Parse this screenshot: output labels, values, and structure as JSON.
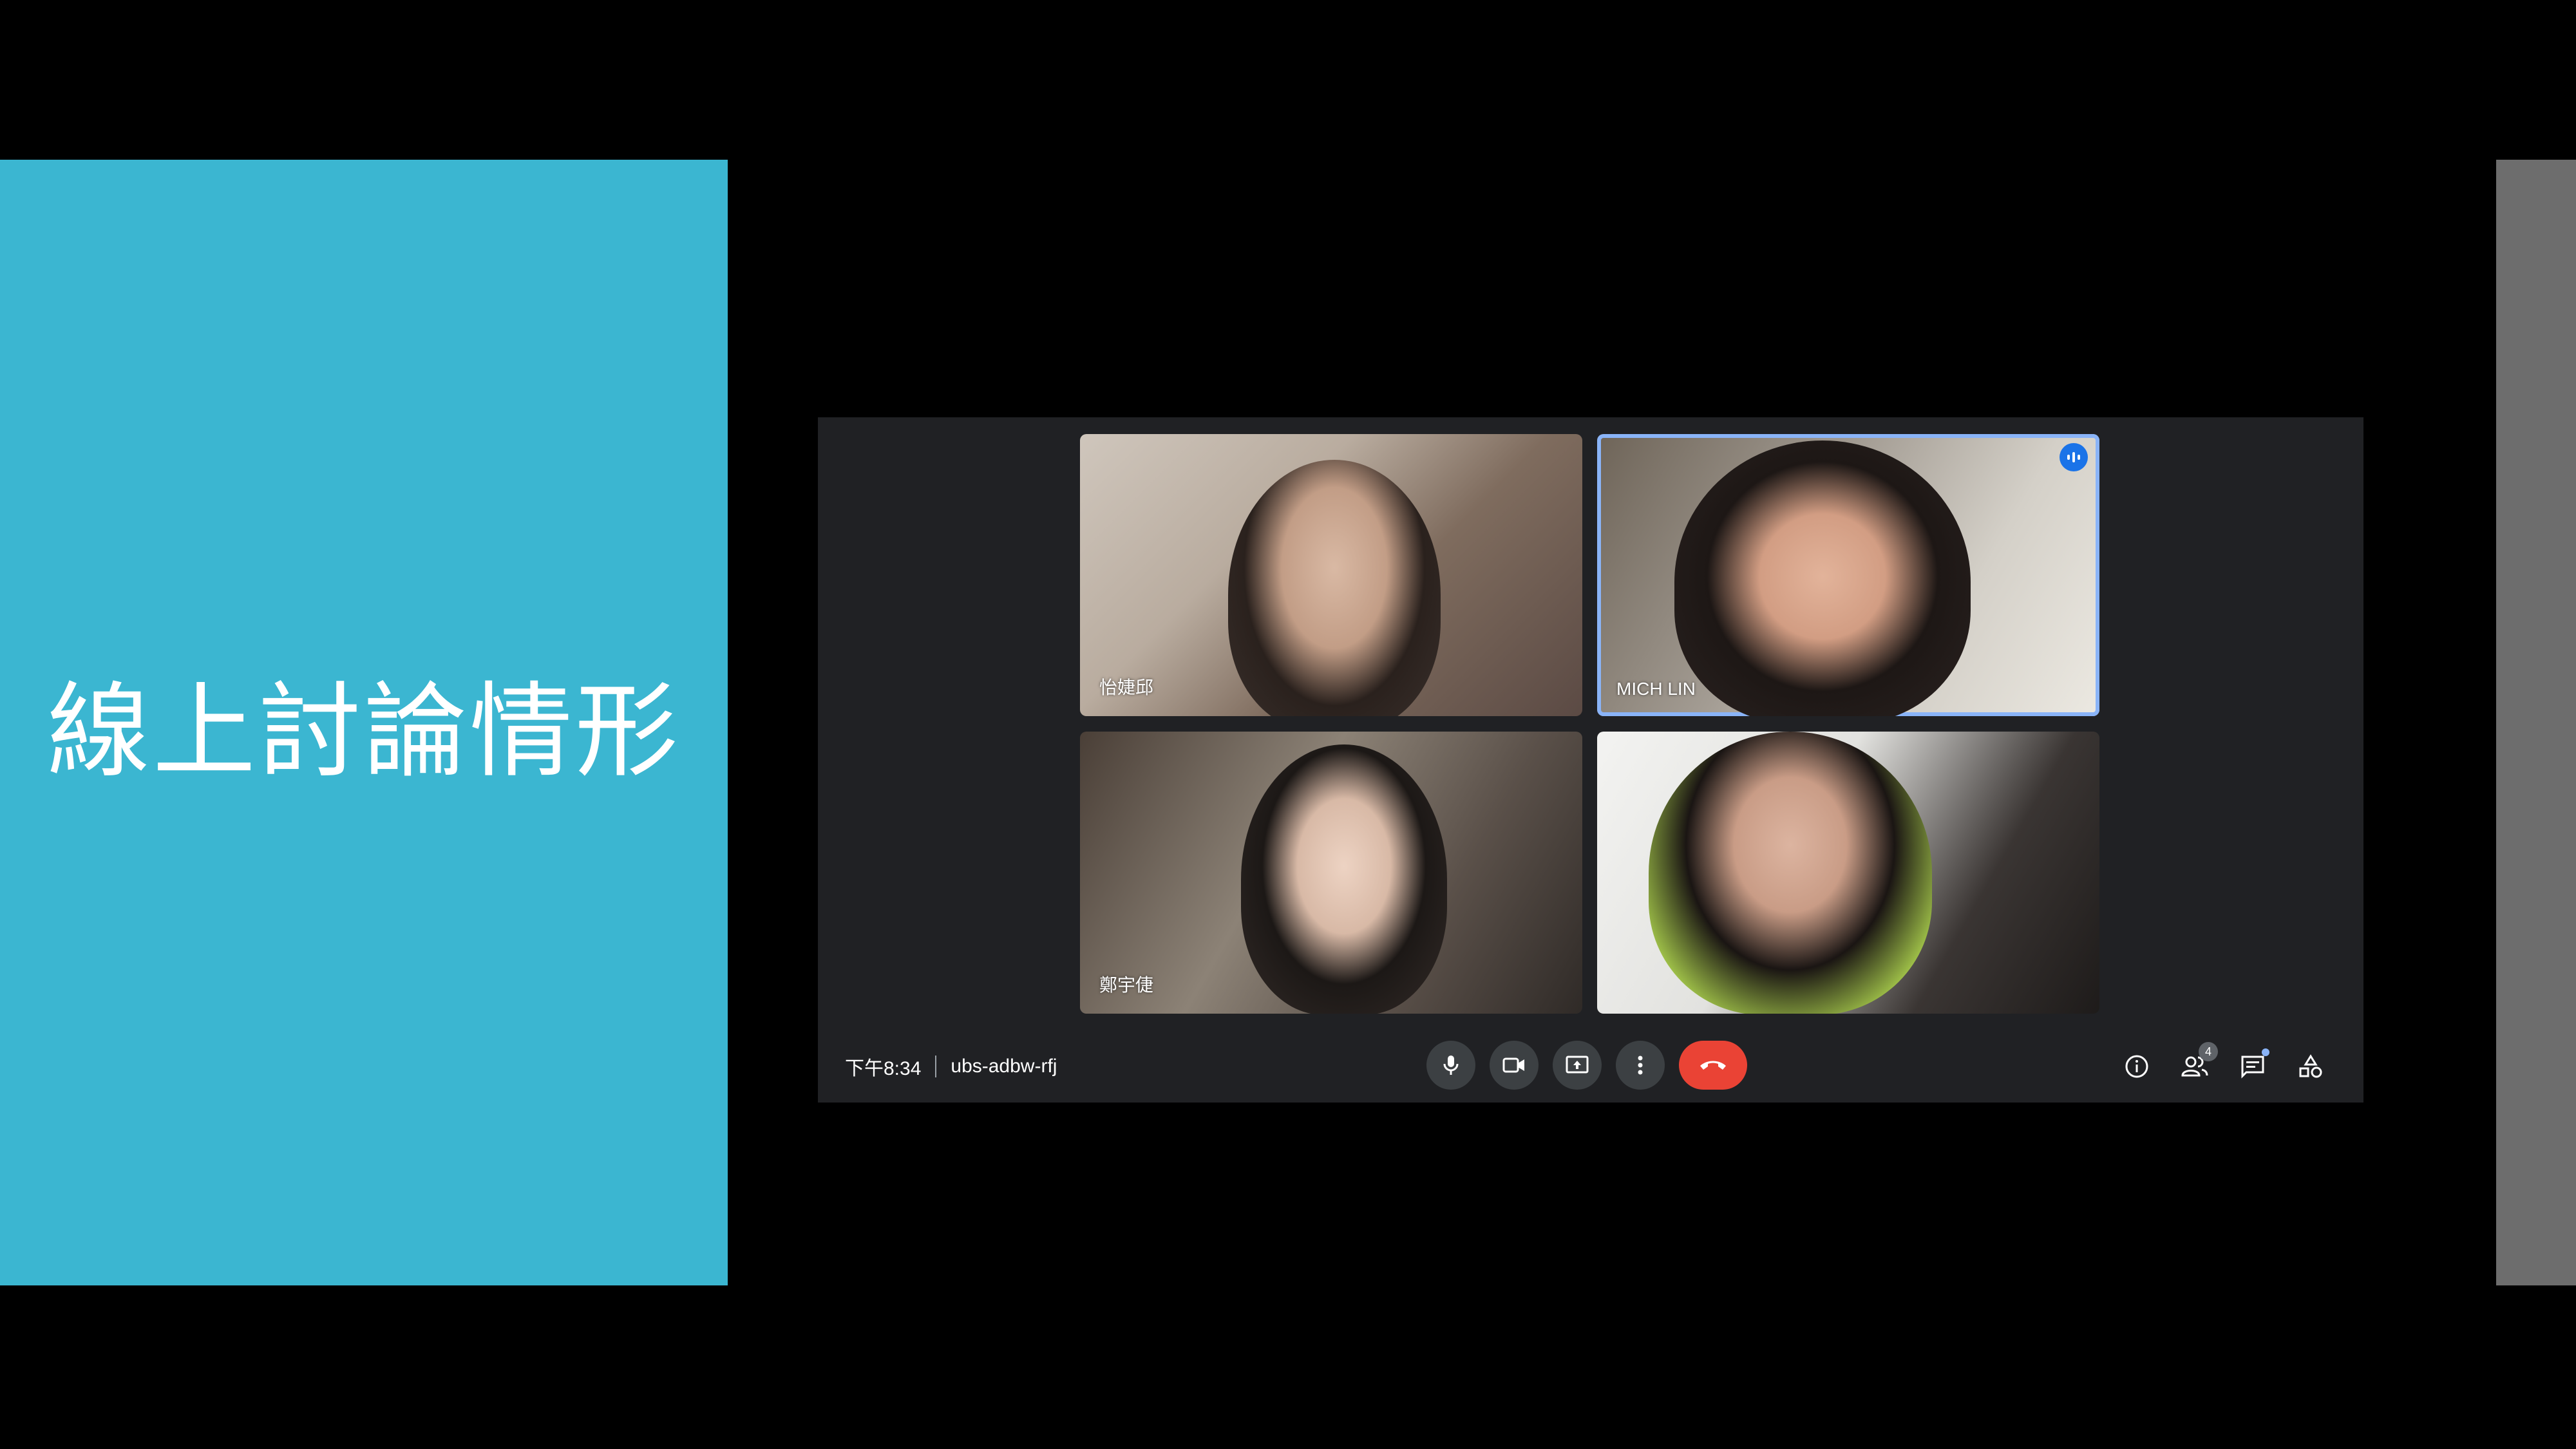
{
  "slide": {
    "title": "線上討論情形",
    "background_color": "#3bb6d1"
  },
  "meet": {
    "participants": [
      {
        "name": "怡婕邱",
        "speaking": false
      },
      {
        "name": "MICH LIN",
        "speaking": true
      },
      {
        "name": "鄭宇倢",
        "speaking": false
      },
      {
        "name": "",
        "speaking": false
      }
    ],
    "time": "下午8:34",
    "meeting_code": "ubs-adbw-rfj",
    "controls": [
      {
        "icon": "microphone-icon"
      },
      {
        "icon": "camera-icon"
      },
      {
        "icon": "present-screen-icon"
      },
      {
        "icon": "more-options-icon"
      },
      {
        "icon": "end-call-icon"
      }
    ],
    "side_controls": [
      {
        "icon": "info-icon"
      },
      {
        "icon": "people-icon",
        "badge": "4"
      },
      {
        "icon": "chat-icon"
      },
      {
        "icon": "activities-icon"
      }
    ],
    "accent_color": "#8ab4f8",
    "end_call_color": "#ea4335"
  }
}
